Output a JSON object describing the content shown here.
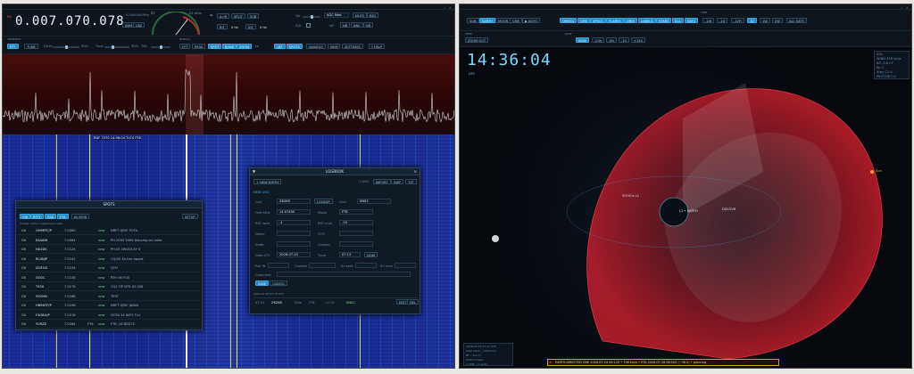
{
  "sdr": {
    "freq_display": "0.007.070.078",
    "top": {
      "rx_label": "RX",
      "freq_small": "0.000000 MHz",
      "mode_buttons": [
        "ADM",
        "LSB"
      ],
      "smeter_label": "S7",
      "smeter_db": "-81 dBm",
      "btn_ab": "A=B",
      "btn_split": "SPLIT",
      "btn_sub": "SUB",
      "btn_rit": "RIT",
      "rit_val": "0 Hz",
      "btn_xit": "XIT",
      "xit_val": "0 Hz",
      "vol_label": "Vol",
      "agc_label": "AGC Med",
      "btn_mute": "MUTE",
      "btn_rec": "REC",
      "sql_label": "SQL",
      "off_label": "off",
      "btn_nb": "NB",
      "btn_anc": "ANC",
      "btn_nr": "NR"
    },
    "row2": {
      "transmit_label": "TRANSMIT",
      "btn_ptt": "PTT",
      "btn_tune": "TUNE",
      "drive_label": "Drive",
      "drive_val": "50%",
      "tune_label": "Tune",
      "tune_val": "30%",
      "mic_label": "Mic",
      "display_label": "DISPLAY",
      "btn_fft": "FFT",
      "btn_peak": "PEAK",
      "btn_spot": "SPOT",
      "btn_band": "BAND",
      "btn_zoom": "ZOOM",
      "zoom_val": "1X",
      "btn_lbt": "LBT",
      "btn_spots": "SPOTS",
      "btn_awards": "AWARDS",
      "btn_mem": "MEM",
      "btn_settings": "SETTINGS",
      "btn_help": "? HELP"
    },
    "waterfall_marker": "RDF 7070 14:36:04 7074 FT8",
    "spots": {
      "title": "SPOTS",
      "tabs": [
        "CW",
        "RTTY",
        "SSB",
        "FT8"
      ],
      "btn_inview": "IN VIEW",
      "btn_setup": "SETUP",
      "subtitle": "Cluster: dxfun-cluster.ham.radio",
      "rows": [
        [
          "DK",
          "OH9RTC/P",
          "7.0080",
          "",
          "new",
          "NRFT QRV! POTA"
        ],
        [
          "DK",
          "EA4AHI",
          "7.0084",
          "",
          "new",
          "PH 2095 3094 Dancing on radio"
        ],
        [
          "DK",
          "HA1DV",
          "7.0124",
          "",
          "new",
          "PH 05 ON1EX KY 0"
        ],
        [
          "DK",
          "RC4N/P",
          "7.0142",
          "",
          "new",
          "CQ/US Eu.the award"
        ],
        [
          "DK",
          "IZ0FGS",
          "7.0154",
          "",
          "new",
          "QTH"
        ],
        [
          "DK",
          "OO2C",
          "7.0158",
          "",
          "new",
          "RTH 06 FOX"
        ],
        [
          "DK",
          "T45X",
          "7.0178",
          "",
          "new",
          "CQ1 TIP NTK 02-028"
        ],
        [
          "DK",
          "IY0ONY",
          "7.0188",
          "",
          "new",
          "TEST"
        ],
        [
          "DK",
          "HB9NTF/P",
          "7.0198",
          "",
          "new",
          "NRFT QRV! JAIWA"
        ],
        [
          "DK",
          "F4GBU/P",
          "7.0218",
          "",
          "new",
          "GOTA 14 INFO Tv1"
        ],
        [
          "DK",
          "YU9ZZ",
          "7.0284",
          "FT8",
          "new",
          "FT8 -16 RDZ70"
        ]
      ]
    },
    "logbook": {
      "title": "LOGBOOK",
      "btn_new": "+ NEW ENTRY",
      "qso_count": "1 QSO",
      "btn_import": "IMPORT",
      "btn_adif": "ADIF",
      "btn_txt": "TXT",
      "section": "NEW QSO",
      "call_label": "Call",
      "call_val": "Z62NS",
      "btn_lookup": "LOOKUP",
      "grid_label": "Grid",
      "grid_val": "KN02",
      "freq_label": "Freq MHz",
      "freq_val": "14.07400",
      "mode_label": "Mode",
      "mode_val": "FT8",
      "rst_sent_label": "RST sent",
      "rst_sent_val": "-1",
      "rst_rcvd_label": "RST rcvd",
      "rst_rcvd_val": "-15",
      "name_label": "Name",
      "qth_label": "QTH",
      "state_label": "State",
      "country_label": "Country",
      "date_label": "Date UTC",
      "date_val": "2026-07-25",
      "time_label": "Time",
      "time_val": "07:12",
      "btn_now": "NOW",
      "pwr_label": "Pwr W",
      "contest_label": "Contest",
      "srx_label": "Srl sent",
      "stx_label": "Srl rcvd",
      "comment_label": "Comment",
      "btn_save": "SAVE",
      "btn_cancel": "CANCEL",
      "log_header": "2026-07-25 07:12 UTC",
      "log_row": [
        "07:12",
        "Z62NS",
        "20m",
        "FT8",
        "-1/-15",
        "KN02"
      ],
      "btn_edit": "EDIT",
      "btn_del": "DEL"
    }
  },
  "sat": {
    "row1": {
      "btn_sun": "SUN",
      "btn_earth": "EARTH",
      "btn_moon": "MOON",
      "btn_cme": "CME",
      "btn_auto": "▶ AUTO",
      "btn_orbits": "ORBITS",
      "btn_cme2": "CME",
      "btn_specs": "SPECS",
      "btn_flares": "FLARES",
      "btn_grid": "GRID",
      "btn_labels": "LABELS",
      "btn_stars": "STARS",
      "btn_ecl": "ECL",
      "btn_sats": "SATS",
      "time_buttons": [
        "-1W",
        "-1D",
        "-12H",
        "1D",
        "1W",
        "2W"
      ],
      "btn_allsats": "ALL SATS",
      "label_time": "TIME"
    },
    "row2": {
      "view_label": "VIEW",
      "btn_zoomout": "ZOOM OUT",
      "lbl_jump": "JUMP",
      "btn_now": "NOW",
      "offsets": [
        "-24h",
        "-6h",
        "-1h",
        "+24h"
      ]
    },
    "clock": "14:36:04",
    "clock_sub": "UTC",
    "info_panel": [
      "SOL",
      "WIND 418 km/s",
      "BZ -3.6 nT",
      "Kp 2",
      "Xray C1.4",
      "PROTON 0.2"
    ],
    "earth_label": "L1 • EARTH",
    "sat_label1": "SOHO ▸ L1",
    "sat_label2": "DSCOVR",
    "planet_label": "Sun",
    "bottom_left": [
      "2026-07-25 07:12 UTC",
      "solar wind ~ 418 km/s",
      "Bt ~ 6.2 nT",
      "ACE/L1 fresh",
      "1 CME • 7 spots"
    ],
    "warning": "EARTH-DIRECTED CME  2026-07-24 09:12Z  •  798 km/s  •  ETA 2026-07-26 08:50Z (~38 h) • glancing",
    "colors": {
      "cme_red": "#d81f2f",
      "accent": "#1f88c2"
    }
  }
}
